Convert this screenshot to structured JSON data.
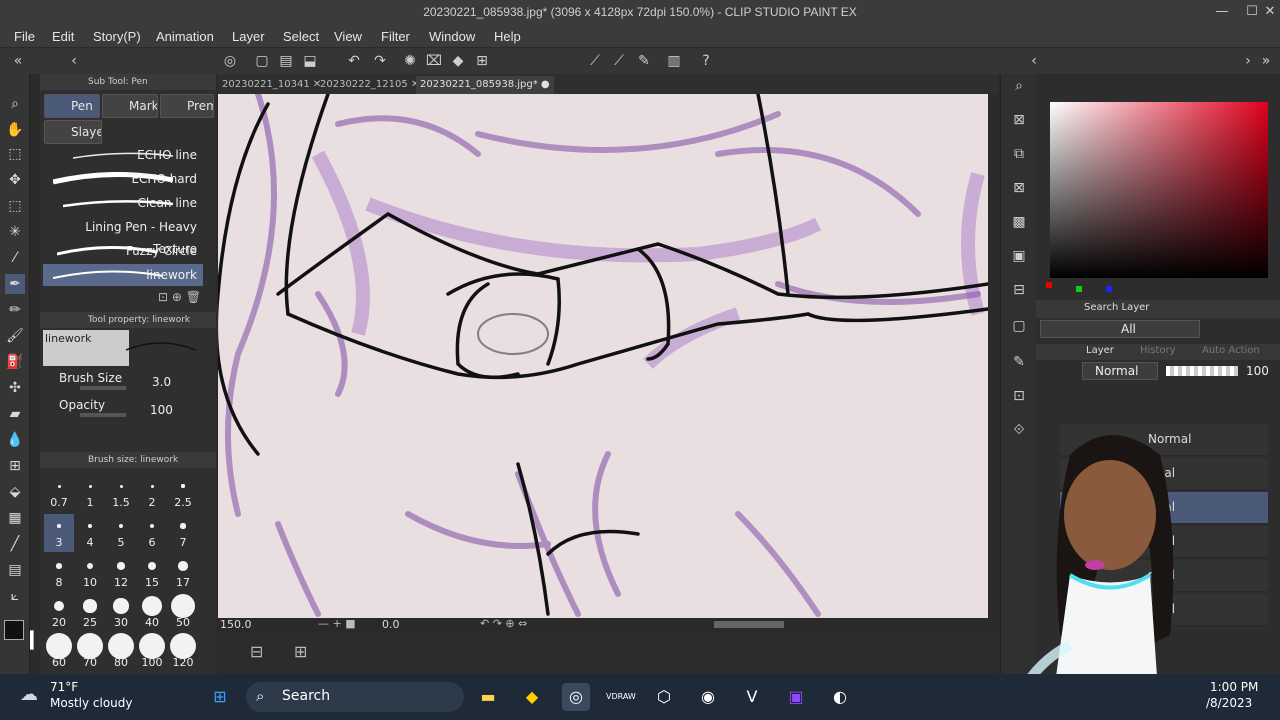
{
  "window": {
    "title": "20230221_085938.jpg* (3096 x 4128px 72dpi 150.0%) - CLIP STUDIO PAINT EX"
  },
  "menu": [
    "File",
    "Edit",
    "Story(P)",
    "Animation",
    "Layer",
    "Select",
    "View",
    "Filter",
    "Window",
    "Help"
  ],
  "subtool": {
    "header": "Sub Tool: Pen",
    "tabs": [
      "Pen",
      "Marki",
      "Prem",
      "Slaye"
    ],
    "brushes": [
      "ECHO line",
      "ECHO hard",
      "Clean line",
      "Lining Pen - Heavy Texture",
      "Fuzzy Circle",
      "linework"
    ],
    "selected_brush": "linework"
  },
  "tool_property": {
    "header": "Tool property: linework",
    "preset_name": "linework",
    "brush_size_label": "Brush Size",
    "brush_size_value": "3.0",
    "opacity_label": "Opacity",
    "opacity_value": "100"
  },
  "brush_size_palette": {
    "header": "Brush size: linework",
    "sizes": [
      "0.7",
      "1",
      "1.5",
      "2",
      "2.5",
      "3",
      "4",
      "5",
      "6",
      "7",
      "8",
      "10",
      "12",
      "15",
      "17",
      "20",
      "25",
      "30",
      "40",
      "50",
      "60",
      "70",
      "80",
      "100",
      "120"
    ],
    "selected": "3"
  },
  "doc_tabs": [
    "20230221_10341",
    "20230222_12105",
    "20230221_085938.jpg*"
  ],
  "status": {
    "zoom": "150.0",
    "angle": "0.0"
  },
  "layer_panel": {
    "search_tab": "Search Layer",
    "filter_value": "All",
    "tabs": [
      "Layer",
      "History",
      "Auto Action"
    ],
    "blend_mode": "Normal",
    "opacity": "100",
    "layers": [
      "Normal",
      "rmal",
      "rmal",
      "rmal",
      "rmal",
      "rmal"
    ]
  },
  "taskbar": {
    "weather_temp": "71°F",
    "weather_desc": "Mostly cloudy",
    "search_placeholder": "Search",
    "time": "1:00 PM",
    "date": "/8/2023"
  },
  "colors": {
    "accent": "#5a6a8c",
    "taskbar": "#1f2a38",
    "canvas_paper": "#e8dede",
    "ink": "#111111",
    "sketch": "#7a4aa0"
  }
}
